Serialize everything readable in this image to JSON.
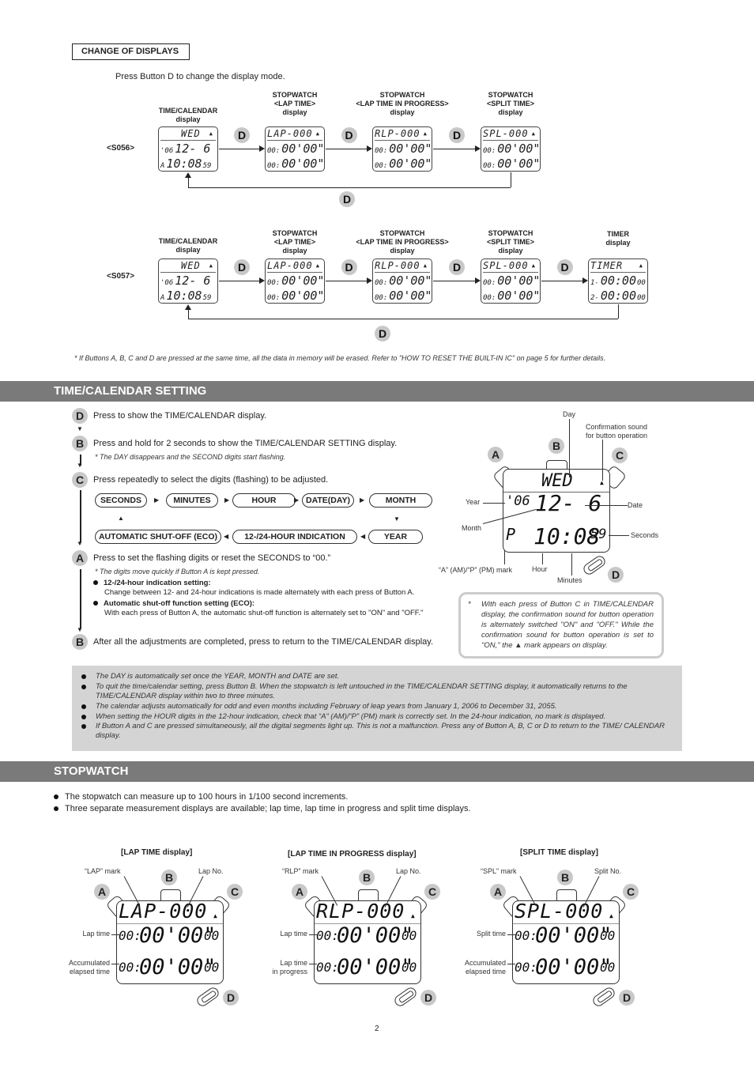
{
  "change_of_displays": {
    "title": "CHANGE OF DISPLAYS",
    "intro": "Press Button D to change the display mode.",
    "button_label": "D",
    "models": [
      {
        "model": "<S056>",
        "displays": [
          {
            "caption_lines": [
              "TIME/CALENDAR",
              "display"
            ],
            "top": "WED",
            "row1": [
              "'06",
              "12- 6",
              ""
            ],
            "row2": [
              "A",
              "10:08",
              "59"
            ]
          },
          {
            "caption_lines": [
              "STOPWATCH",
              "<LAP TIME>",
              "display"
            ],
            "top": "LAP-000",
            "row1": [
              "00:",
              "00'00\"",
              "00"
            ],
            "row2": [
              "00:",
              "00'00\"",
              "00"
            ]
          },
          {
            "caption_lines": [
              "STOPWATCH",
              "<LAP TIME IN PROGRESS>",
              "display"
            ],
            "top": "RLP-000",
            "row1": [
              "00:",
              "00'00\"",
              "00"
            ],
            "row2": [
              "00:",
              "00'00\"",
              "00"
            ]
          },
          {
            "caption_lines": [
              "STOPWATCH",
              "<SPLIT TIME>",
              "display"
            ],
            "top": "SPL-000",
            "row1": [
              "00:",
              "00'00\"",
              "00"
            ],
            "row2": [
              "00:",
              "00'00\"",
              "00"
            ]
          }
        ]
      },
      {
        "model": "<S057>",
        "displays": [
          {
            "caption_lines": [
              "TIME/CALENDAR",
              "display"
            ],
            "top": "WED",
            "row1": [
              "'06",
              "12- 6",
              ""
            ],
            "row2": [
              "A",
              "10:08",
              "59"
            ]
          },
          {
            "caption_lines": [
              "STOPWATCH",
              "<LAP TIME>",
              "display"
            ],
            "top": "LAP-000",
            "row1": [
              "00:",
              "00'00\"",
              "00"
            ],
            "row2": [
              "00:",
              "00'00\"",
              "00"
            ]
          },
          {
            "caption_lines": [
              "STOPWATCH",
              "<LAP TIME IN PROGRESS>",
              "display"
            ],
            "top": "RLP-000",
            "row1": [
              "00:",
              "00'00\"",
              "00"
            ],
            "row2": [
              "00:",
              "00'00\"",
              "00"
            ]
          },
          {
            "caption_lines": [
              "STOPWATCH",
              "<SPLIT TIME>",
              "display"
            ],
            "top": "SPL-000",
            "row1": [
              "00:",
              "00'00\"",
              "00"
            ],
            "row2": [
              "00:",
              "00'00\"",
              "00"
            ]
          },
          {
            "caption_lines": [
              "TIMER",
              "display"
            ],
            "top": "TIMER",
            "row1": [
              "1-",
              "00:00",
              "00"
            ],
            "row2": [
              "2-",
              "00:00",
              "00"
            ]
          }
        ]
      }
    ],
    "footnote": "*    If Buttons A, B, C and D are pressed at the same time, all the data in memory will be erased. Refer to \"HOW TO RESET THE BUILT-IN IC\" on page 5 for further details."
  },
  "time_calendar_setting": {
    "heading": "TIME/CALENDAR SETTING",
    "steps": [
      {
        "button": "D",
        "text": "Press to show the TIME/CALENDAR display."
      },
      {
        "button": "B",
        "text": "Press and hold for 2 seconds to show the TIME/CALENDAR SETTING display.",
        "note": "*    The DAY  disappears and the SECOND digits start flashing."
      },
      {
        "button": "C",
        "text": "Press repeatedly to select the digits (flashing) to be adjusted."
      },
      {
        "button": "A",
        "text": "Press to set the flashing digits or reset the SECONDS to “00.”",
        "note": "*    The digits move quickly if Button A is kept pressed."
      },
      {
        "button": "B",
        "text": "After all the adjustments are completed, press to return to the TIME/CALENDAR display."
      }
    ],
    "sequence_row1": [
      "SECONDS",
      "MINUTES",
      "HOUR",
      "DATE(DAY)",
      "MONTH"
    ],
    "sequence_row2": [
      "AUTOMATIC SHUT-OFF (ECO)",
      "12-/24-HOUR INDICATION",
      "YEAR"
    ],
    "sub_bullets": [
      {
        "title": "12-/24-hour indication setting:",
        "text": "Change between 12- and 24-hour indications is made alternately with each press of Button A."
      },
      {
        "title": "Automatic shut-off function setting (ECO):",
        "text": "With each press of Button A, the automatic shut-off function is alternately set to \"ON\" and \"OFF.\""
      }
    ],
    "watch_diagram": {
      "display_top": "WED",
      "year": "'06",
      "date": "12- 6",
      "ampm": "P",
      "time": "10:08",
      "seconds": "59",
      "labels": {
        "day": "Day",
        "sound": "Confirmation sound\nfor button operation",
        "year": "Year",
        "month": "Month",
        "date": "Date",
        "seconds": "Seconds",
        "ampm": "“A” (AM)/“P” (PM) mark",
        "hour": "Hour",
        "minutes": "Minutes"
      },
      "buttons": [
        "A",
        "B",
        "C",
        "D"
      ]
    },
    "sound_note": "With each press of Button C in TIME/CALENDAR display, the confirmation sound for button operation is alternately switched \"ON\" and \"OFF.\" While the confirmation sound for button operation is set to \"ON,\" the ▲ mark appears on display.",
    "gray_notes": [
      "The DAY is automatically set once the YEAR, MONTH and DATE are set.",
      "To quit the time/calendar setting, press Button B. When the stopwatch is left untouched in the TIME/CALENDAR SETTING display, it automatically returns to the TIME/CALENDAR display within two to three minutes.",
      "The calendar adjusts automatically for odd and even months including February of leap years from January 1, 2006 to December 31, 2055.",
      "When setting the HOUR digits in the 12-hour indication, check that “A” (AM)/“P” (PM) mark is correctly set.  In the 24-hour indication, no mark is displayed.",
      "If Button A and C are pressed simultaneously, all the digital segments light up. This is not a malfunction. Press any of Button A, B, C or D to return to the TIME/ CALENDAR display."
    ]
  },
  "stopwatch": {
    "heading": "STOPWATCH",
    "bullets": [
      "The stopwatch can measure up to 100 hours in 1/100 second increments.",
      "Three separate measurement displays are available; lap time, lap time in progress and split time displays."
    ],
    "diagrams": [
      {
        "title": "[LAP TIME display]",
        "top": "LAP-000",
        "mark_label": "“LAP” mark",
        "no_label": "Lap No.",
        "row1_label": "Lap time",
        "row2_label": "Accumulated\nelapsed time"
      },
      {
        "title": "[LAP TIME IN PROGRESS display]",
        "top": "RLP-000",
        "mark_label": "“RLP” mark",
        "no_label": "Lap No.",
        "row1_label": "Lap time",
        "row2_label": "Lap time\nin progress"
      },
      {
        "title": "[SPLIT TIME display]",
        "top": "SPL-000",
        "mark_label": "“SPL” mark",
        "no_label": "Split No.",
        "row1_label": "Split time",
        "row2_label": "Accumulated\nelapsed time"
      }
    ],
    "digits": {
      "small": "00:",
      "big": "00'00\"",
      "hund": "00"
    }
  },
  "page_number": "2"
}
